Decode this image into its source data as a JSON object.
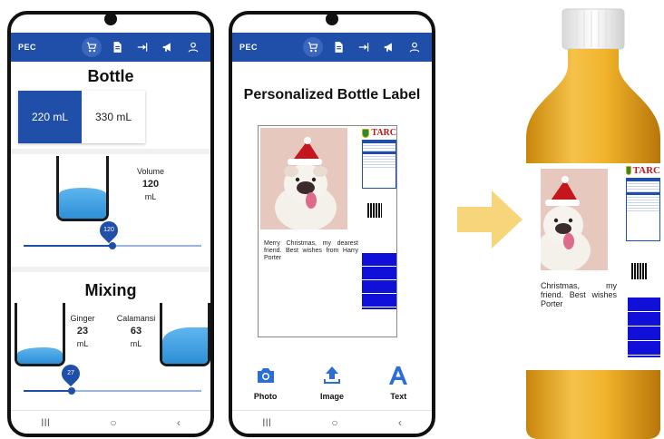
{
  "app": {
    "brand": "PEC"
  },
  "nav_icons": [
    "cart-icon",
    "document-icon",
    "login-icon",
    "megaphone-icon",
    "user-icon"
  ],
  "system_nav": {
    "recent": "III",
    "home": "○",
    "back": "‹"
  },
  "screen1": {
    "bottle_title": "Bottle",
    "sizes": [
      {
        "label": "220 mL",
        "selected": true
      },
      {
        "label": "330 mL",
        "selected": false
      }
    ],
    "volume": {
      "label": "Volume",
      "value": "120",
      "unit": "mL",
      "slider_label": "120",
      "slider_fraction": 0.5
    },
    "mixing_title": "Mixing",
    "mixing": {
      "left_name": "Ginger",
      "left_value": "23",
      "left_unit": "mL",
      "right_name": "Calamansi",
      "right_value": "63",
      "right_unit": "mL",
      "slider_label": "27",
      "slider_fraction": 0.27
    }
  },
  "screen2": {
    "title": "Personalized Bottle Label",
    "message": "Merry Christmas, my dearest friend. Best wishes from Harry Porter",
    "brand_mark": "TARC",
    "tools": [
      {
        "label": "Photo",
        "icon": "camera-icon"
      },
      {
        "label": "Image",
        "icon": "upload-icon"
      },
      {
        "label": "Text",
        "icon": "text-icon"
      }
    ]
  },
  "bottle_preview": {
    "message": "Christmas, my friend. Best wishes Porter",
    "brand_mark": "TARC"
  },
  "colors": {
    "primary": "#1f4fa8",
    "water": "#3a9be0",
    "arrow": "#f7d57a",
    "juice": "#e5a216",
    "label_blue": "#1010d8"
  }
}
